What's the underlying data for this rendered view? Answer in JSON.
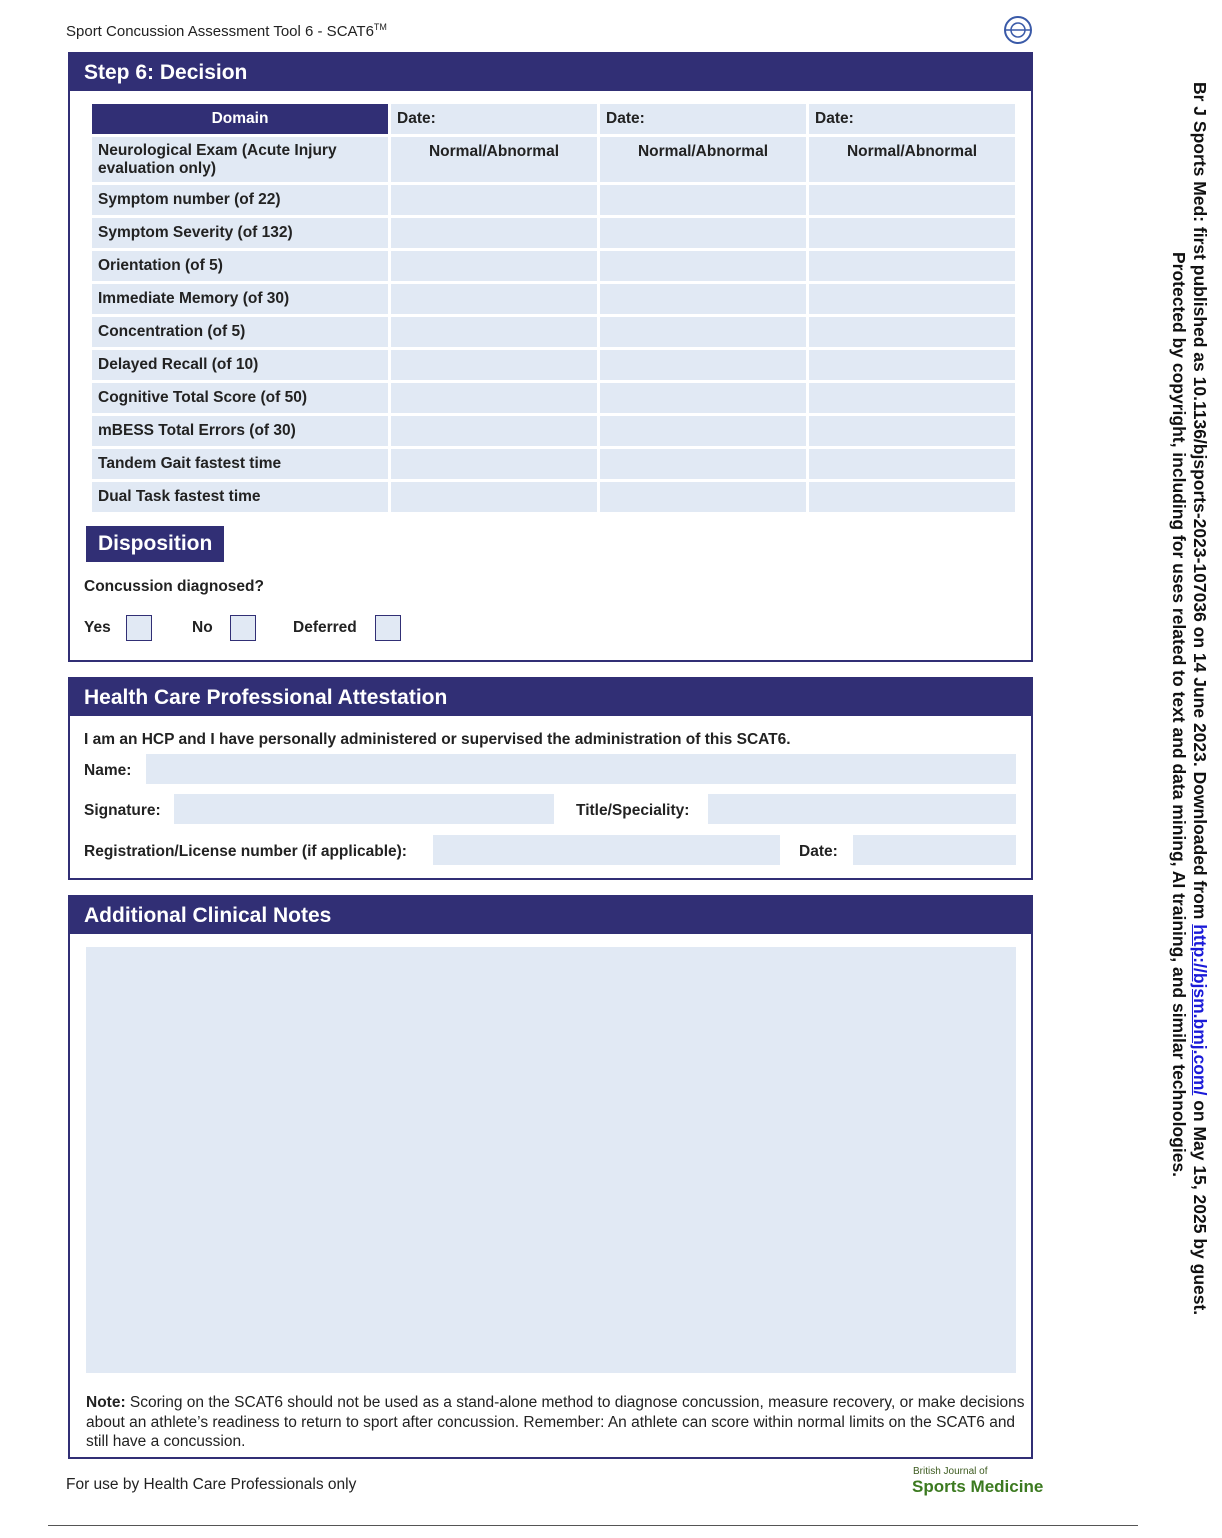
{
  "header": {
    "title": "Sport Concussion Assessment Tool 6 - SCAT6",
    "tm": "TM"
  },
  "decision": {
    "title": "Step 6: Decision",
    "domain_header": "Domain",
    "date_label": "Date:",
    "neuro_value": "Normal/Abnormal",
    "rows": [
      "Neurological Exam (Acute Injury evaluation only)",
      "Symptom number (of 22)",
      "Symptom Severity (of 132)",
      "Orientation (of 5)",
      "Immediate Memory (of 30)",
      "Concentration (of 5)",
      "Delayed Recall (of 10)",
      "Cognitive Total Score (of 50)",
      "mBESS Total Errors (of 30)",
      "Tandem Gait fastest time",
      "Dual Task fastest time"
    ]
  },
  "disposition": {
    "title": "Disposition",
    "question": "Concussion diagnosed?",
    "options": [
      "Yes",
      "No",
      "Deferred"
    ]
  },
  "attestation": {
    "title": "Health Care Professional Attestation",
    "statement": "I am an HCP and I have personally administered or supervised the administration of this SCAT6.",
    "name_label": "Name:",
    "signature_label": "Signature:",
    "title_label": "Title/Speciality:",
    "registration_label": "Registration/License number (if applicable):",
    "date_label": "Date:"
  },
  "notes": {
    "title": "Additional Clinical Notes",
    "note_bold": "Note:",
    "note_text": " Scoring on the SCAT6 should not be used as a stand-alone method to diagnose concussion, measure recovery, or make decisions about an athlete’s readiness to return to sport after concussion. Remember: An athlete can score within normal limits on the SCAT6 and still have a concussion."
  },
  "footer": {
    "use_note": "For use by Health Care Professionals only",
    "journal_small": "British Journal of",
    "journal_big": "Sports Medicine"
  },
  "sidebar": {
    "line1_pre": "Br J Sports Med: first published as 10.1136/bjsports-2023-107036 on 14 June 2023. Downloaded from ",
    "line1_link": "http://bjsm.bmj.com/",
    "line1_post": " on May 15, 2025 by guest.",
    "line2": "Protected by copyright, including for uses related to text and data mining, AI training, and similar technologies."
  },
  "colors": {
    "brand": "#312f75",
    "field": "#e1e9f4"
  }
}
